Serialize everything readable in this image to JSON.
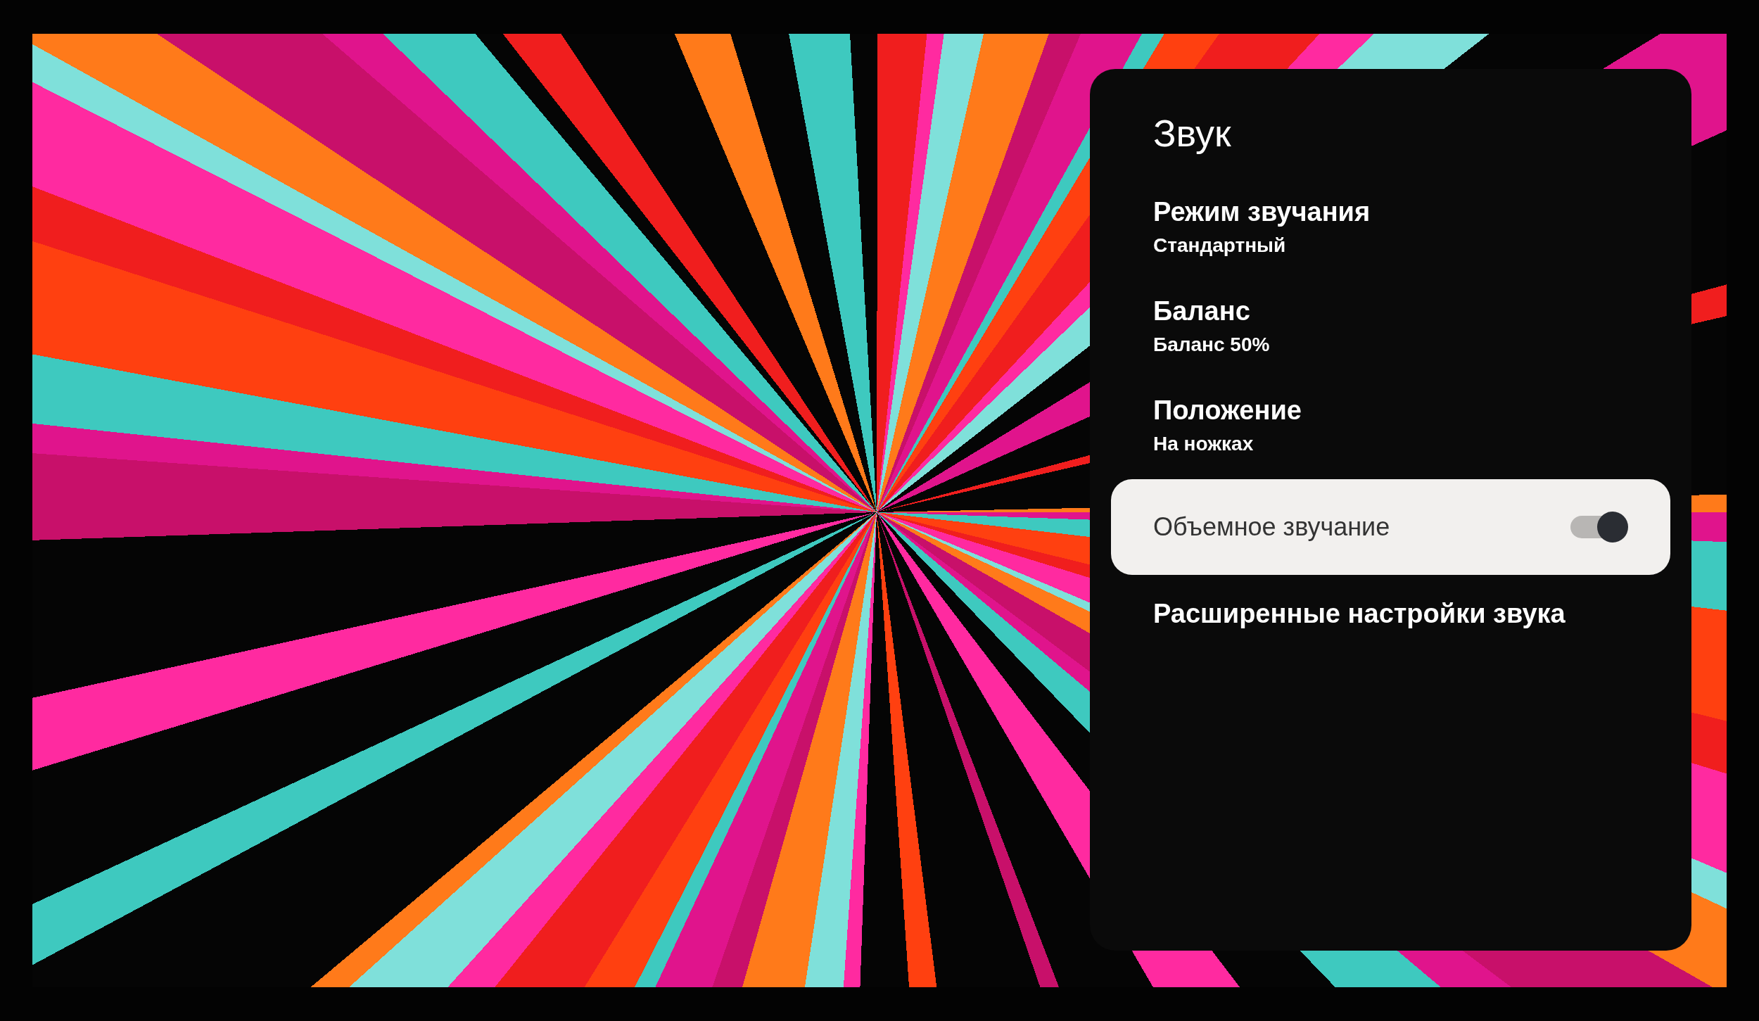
{
  "panel": {
    "title": "Звук",
    "items": [
      {
        "kind": "setting",
        "label": "Режим звучания",
        "value": "Стандартный",
        "selected": false
      },
      {
        "kind": "setting",
        "label": "Баланс",
        "value": "Баланс 50%",
        "selected": false
      },
      {
        "kind": "setting",
        "label": "Положение",
        "value": "На ножках",
        "selected": false
      },
      {
        "kind": "toggle",
        "label": "Объемное звучание",
        "on": true,
        "selected": true
      },
      {
        "kind": "link",
        "label": "Расширенные настройки звука",
        "selected": false
      }
    ]
  }
}
